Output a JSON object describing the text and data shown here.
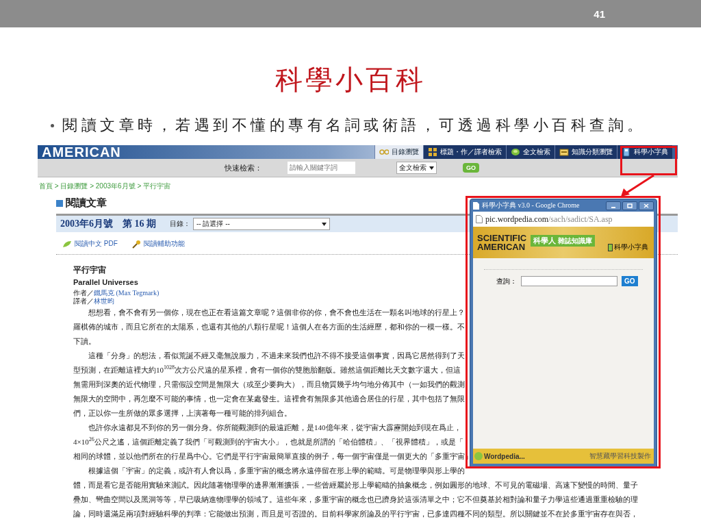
{
  "slide": {
    "page_number": "41",
    "title": "科學小百科",
    "bullet": "閱讀文章時，若遇到不懂的專有名詞或術語，可透過科學小百科查詢。"
  },
  "site": {
    "logo": "AMERICAN",
    "nav": [
      {
        "label": "目錄瀏覽",
        "selected": true
      },
      {
        "label": "標題・作／譯者檢索",
        "selected": false
      },
      {
        "label": "全文檢索",
        "selected": false
      },
      {
        "label": "知識分類瀏覽",
        "selected": false
      },
      {
        "label": "科學小字典",
        "selected": false
      }
    ],
    "search": {
      "label": "快速檢索：",
      "placeholder": "請輸入關鍵字詞",
      "scope": "全文檢索",
      "button": "GO"
    },
    "breadcrumb": "首頁 > 目錄瀏覽 > 2003年6月號 > 平行宇宙",
    "section_title": "閱讀文章",
    "issue": "2003年6月號　第 16 期",
    "toc_label": "目錄：",
    "toc_select": "-- 請選擇 --",
    "tools": [
      {
        "label": "閱讀中文 PDF"
      },
      {
        "label": "閱讀輔助功能"
      }
    ]
  },
  "article": {
    "title": "平行宇宙",
    "subtitle": "Parallel Universes",
    "author_label": "作者／",
    "author": "鐵馬克 (Max Tegmark)",
    "translator_label": "譯者／",
    "translator": "林世昀",
    "lines": [
      {
        "text": "想想看，會不會有另一個你，現在也正在看這篇文章呢？這個非你的你，會不會也生活在一顆名叫地球的行星上？",
        "indent": true
      },
      {
        "text": "羅棋佈的城市，而且它所在的太陽系，也還有其他的八顆行星呢！這個人在各方面的生活經歷，都和你的一模一樣。不",
        "indent": false
      },
      {
        "text": "下讀。",
        "indent": false
      },
      {
        "text": "這種「分身」的想法，看似荒誕不經又毫無說服力，不過未來我們也許不得不接受這個事實，因爲它居然得到了天",
        "indent": true
      },
      {
        "text": "型預測，在距離這裡大約10$^{10}$$^{28}$次方公尺遠的星系裡，會有一個你的雙胞胎翻版。雖然這個距離比天文數字還大，但這",
        "indent": false
      },
      {
        "text": "無需用到深奧的近代物理，只需假設空間是無限大（或至少要夠大），而且物質幾乎均勻地分佈其中（一如我們的觀測",
        "indent": false
      },
      {
        "text": "無限大的空間中，再怎麼不可能的事情，也一定會在某處發生。這裡會有無限多其他適合居住的行星，其中包括了無限",
        "indent": false
      },
      {
        "text": "們，正以你一生所做的眾多選擇，上演著每一種可能的排列組合。",
        "indent": false
      },
      {
        "text": "也許你永遠都見不到你的另一個分身。你所能觀測到的最遠距離，是140億年來，從宇宙大霹靂開始到現在爲止，",
        "indent": true
      },
      {
        "text": "4×10$^{26}$公尺之遙，這個距離定義了我們「可觀測到的宇宙大小」，也就是所謂的「哈伯體積」、「視界體積」，或是「",
        "indent": false
      },
      {
        "text": "相同的球體，並以他們所在的行星爲中心。它們是平行宇宙最簡單直接的例子，每一個宇宙僅是一個更大的「多重宇宙」",
        "indent": false
      },
      {
        "text": "根據這個「宇宙」的定義，或許有人會以爲，多重宇宙的概念將永遠停留在形上學的範疇。可是物理學與形上學的",
        "indent": true
      },
      {
        "text": "體，而是看它是否能用實驗來測試。因此隨著物理學的邊界漸漸擴張，一些曾經屬於形上學範疇的抽象概念，例如圓形的地球、不可見的電磁場、高速下變慢的時間、量子",
        "indent": false
      },
      {
        "text": "疊加、彎曲空間以及黑洞等等，早已吸納進物理學的領域了。這些年來，多重宇宙的概念也已躋身於這張清單之中；它不但奠基於相對論和量子力學這些通過重重檢驗的理",
        "indent": false
      },
      {
        "text": "論，同時還滿足兩項對經驗科學的判準：它能做出預測，而且是可否證的。目前科學家所論及的平行宇宙，已多達四種不同的類型。所以關鍵並不在於多重宇宙存在與否，",
        "indent": false
      }
    ]
  },
  "popup": {
    "title": "科學小字典 v3.0 - Google Chrome",
    "url_host": "pic.wordpedia.com",
    "url_path": "/sach/sadict/SA.asp",
    "logo_top": "SCIENTIFIC",
    "logo_bottom": "AMERICAN",
    "badge": "科學人",
    "badge_sub": "雜誌知識庫",
    "dictionary_label": "科學小字典",
    "query_label": "查詢：",
    "button": "GO",
    "footer_logo": "Wordpedia...",
    "footer_credit": "智慧藏學習科技製作"
  }
}
